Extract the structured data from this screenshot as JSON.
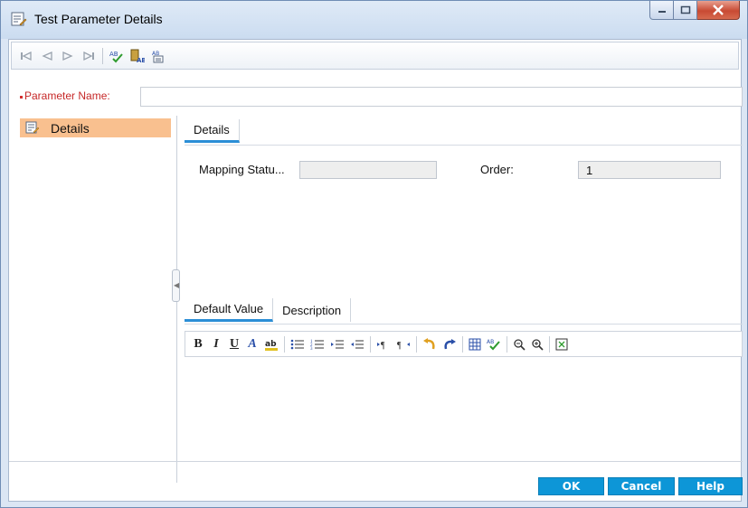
{
  "window": {
    "title": "Test Parameter Details"
  },
  "toolbar": {
    "icons": [
      "first-record-icon",
      "previous-record-icon",
      "next-record-icon",
      "last-record-icon",
      "spell-check-icon",
      "thesaurus-icon",
      "spelling-options-icon"
    ]
  },
  "parameter": {
    "label": "Parameter Name:",
    "value": ""
  },
  "sidebar": {
    "items": [
      {
        "label": "Details",
        "selected": true
      }
    ]
  },
  "details_tabs": [
    {
      "label": "Details",
      "active": true
    }
  ],
  "fields": {
    "mapping_status": {
      "label": "Mapping Statu...",
      "value": ""
    },
    "order": {
      "label": "Order:",
      "value": "1"
    }
  },
  "value_tabs": [
    {
      "label": "Default Value",
      "active": true
    },
    {
      "label": "Description",
      "active": false
    }
  ],
  "rich_text": {
    "bold": "B",
    "italic": "I",
    "underline": "U",
    "font": "A"
  },
  "buttons": {
    "ok": "OK",
    "cancel": "Cancel",
    "help": "Help"
  },
  "colors": {
    "accent": "#0d96d7",
    "selection": "#f9c08f",
    "required": "#c62828"
  }
}
